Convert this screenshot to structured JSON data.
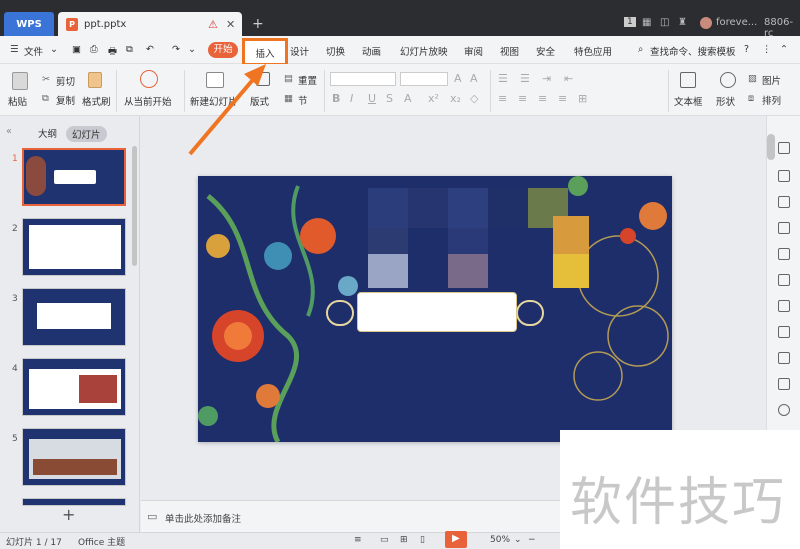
{
  "titlebar": {
    "app_tab": "WPS",
    "doc_tab": "ppt.pptx",
    "user": "foreve...",
    "session": "8806-rc",
    "badge": "1"
  },
  "menu": {
    "file": "文件",
    "tabs": [
      "开始",
      "插入",
      "设计",
      "切换",
      "动画",
      "幻灯片放映",
      "审阅",
      "视图",
      "安全",
      "特色应用"
    ],
    "search": "查找命令、搜索模板"
  },
  "ribbon": {
    "paste": "粘贴",
    "cut": "剪切",
    "copy": "复制",
    "format_painter": "格式刷",
    "from_current": "从当前开始",
    "new_slide": "新建幻灯片",
    "layout": "版式",
    "reset": "重置",
    "section": "节",
    "textbox": "文本框",
    "shape": "形状",
    "picture": "图片",
    "arrange": "排列"
  },
  "left_panel": {
    "tab_outline": "大纲",
    "tab_slides": "幻灯片",
    "slide_numbers": [
      "1",
      "2",
      "3",
      "4",
      "5"
    ]
  },
  "notes": {
    "placeholder": "单击此处添加备注"
  },
  "status": {
    "slide_count": "幻灯片 1 / 17",
    "theme": "Office 主题",
    "zoom": "50%"
  },
  "watermark": {
    "text": "软件技巧"
  },
  "colors": {
    "accent": "#e8633a",
    "highlight": "#f07522",
    "slide_bg": "#1d2e6b"
  }
}
